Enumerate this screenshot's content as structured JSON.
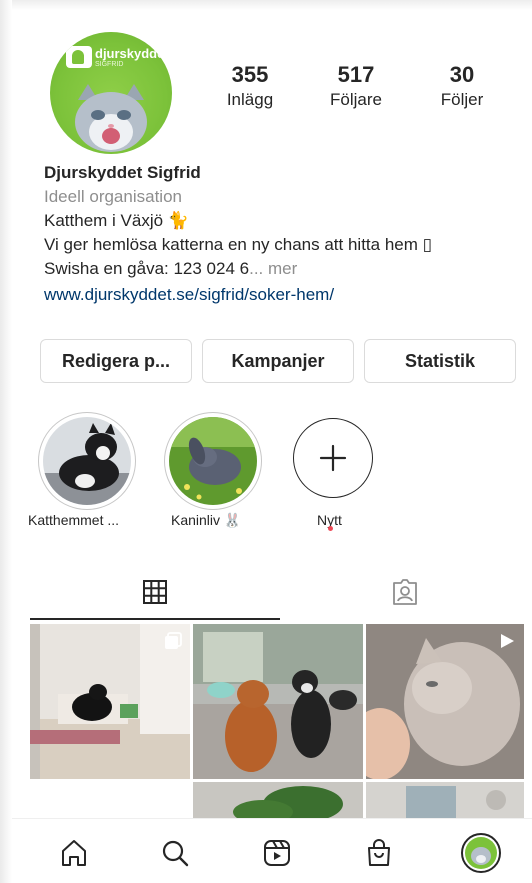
{
  "profile": {
    "avatar_logo_text": "djurskyddet",
    "avatar_logo_sub": "SIGFRID",
    "name": "Djurskyddet Sigfrid",
    "category": "Ideell organisation",
    "bio_line_1": "Katthem i Växjö 🐈",
    "bio_line_2": "Vi ger hemlösa katterna en ny chans att hitta hem ▯",
    "bio_line_3": "Swisha en gåva: 123 024 6",
    "bio_more": "... mer",
    "link": "www.djurskyddet.se/sigfrid/soker-hem/"
  },
  "stats": [
    {
      "value": "355",
      "label": "Inlägg"
    },
    {
      "value": "517",
      "label": "Följare"
    },
    {
      "value": "30",
      "label": "Följer"
    }
  ],
  "buttons": {
    "edit": "Redigera p...",
    "campaigns": "Kampanjer",
    "statistics": "Statistik"
  },
  "highlights": [
    {
      "label": "Katthemmet ..."
    },
    {
      "label": "Kaninliv 🐰"
    },
    {
      "label": "Nytt"
    }
  ],
  "tabs": {
    "active": "grid",
    "items": [
      "grid-icon",
      "tagged-icon"
    ]
  },
  "nav": [
    "home-icon",
    "search-icon",
    "reels-icon",
    "shop-icon",
    "profile-avatar"
  ],
  "colors": {
    "accent_green": "#7cc23a",
    "link": "#00376b",
    "muted": "#8e8e8e",
    "border": "#dbdbdb",
    "notification_dot": "#ed4956"
  }
}
